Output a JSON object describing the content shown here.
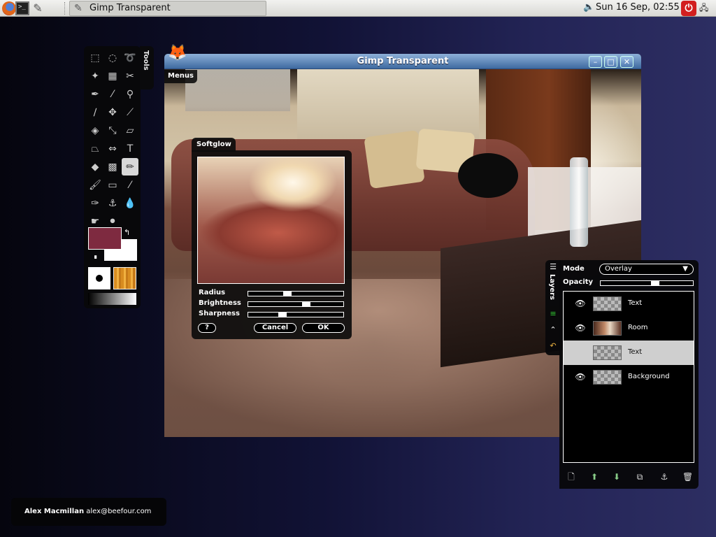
{
  "panel": {
    "task_title": "Gimp Transparent",
    "clock": "Sun 16 Sep, 02:55"
  },
  "toolbox": {
    "tab_label": "Tools",
    "colors": {
      "foreground": "#7e2a40",
      "background": "#ffffff"
    }
  },
  "window": {
    "title": "Gimp Transparent",
    "menus_label": "Menus"
  },
  "softglow": {
    "title": "Softglow",
    "radius_label": "Radius",
    "brightness_label": "Brightness",
    "sharpness_label": "Sharpness",
    "radius_value": 0.4,
    "brightness_value": 0.62,
    "sharpness_value": 0.35,
    "help_label": "?",
    "cancel_label": "Cancel",
    "ok_label": "OK"
  },
  "layers": {
    "tab_label": "Layers",
    "mode_label": "Mode",
    "mode_value": "Overlay",
    "opacity_label": "Opacity",
    "opacity_value": 0.6,
    "items": [
      {
        "name": "Text",
        "visible": true,
        "selected": false
      },
      {
        "name": "Room",
        "visible": true,
        "selected": false
      },
      {
        "name": "Text",
        "visible": false,
        "selected": true
      },
      {
        "name": "Background",
        "visible": true,
        "selected": false
      }
    ]
  },
  "credit": {
    "name": "Alex Macmillan",
    "email": "alex@beefour.com"
  }
}
